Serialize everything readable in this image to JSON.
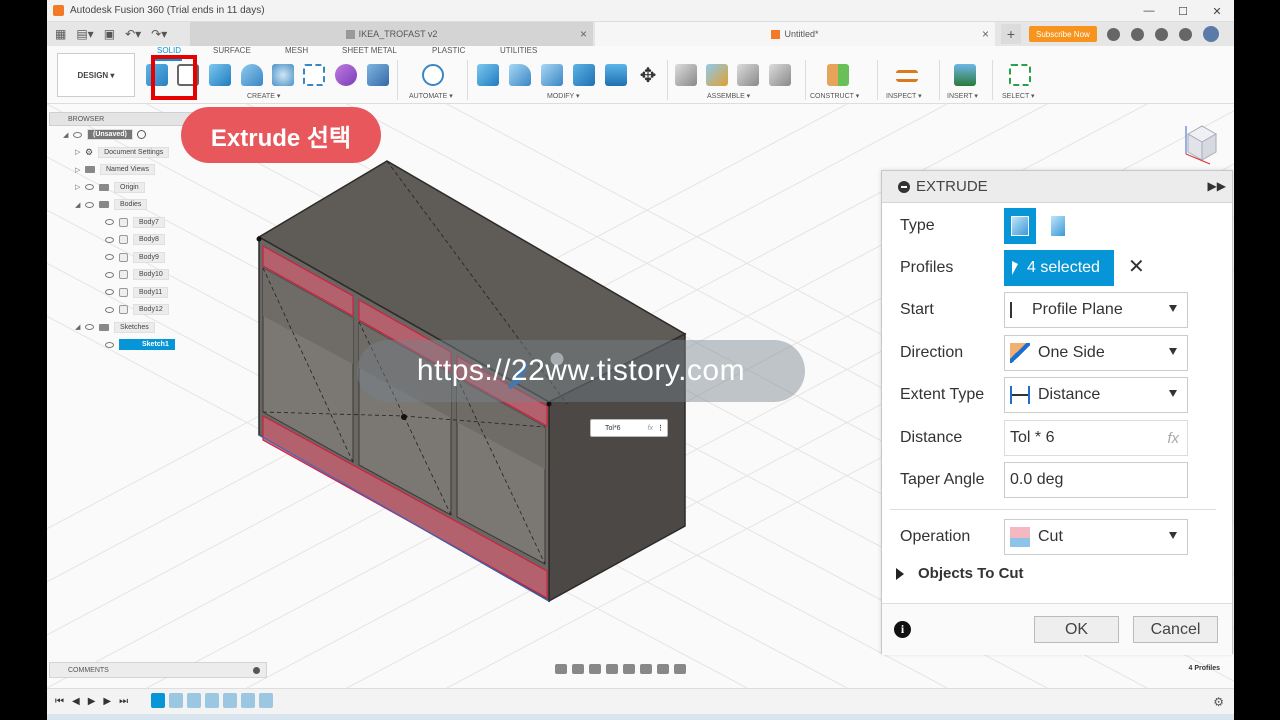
{
  "window": {
    "title": "Autodesk Fusion 360 (Trial ends in 11 days)",
    "controls": [
      "—",
      "☐",
      "✕"
    ]
  },
  "tabs": {
    "inactive": "IKEA_TROFAST v2",
    "active": "Untitled*",
    "subscribe": "Subscribe Now"
  },
  "ribbon": {
    "design": "DESIGN ▾",
    "tab_labels": [
      "SOLID",
      "SURFACE",
      "MESH",
      "SHEET METAL",
      "PLASTIC",
      "UTILITIES"
    ],
    "groups": [
      "CREATE ▾",
      "AUTOMATE ▾",
      "MODIFY ▾",
      "ASSEMBLE ▾",
      "CONSTRUCT ▾",
      "INSPECT ▾",
      "INSERT ▾",
      "SELECT ▾"
    ]
  },
  "callout": "Extrude 선택",
  "watermark": "https://22ww.tistory.com",
  "browser": {
    "header": "BROWSER",
    "root": "(Unsaved)",
    "items": {
      "doc_settings": "Document Settings",
      "named_views": "Named Views",
      "origin": "Origin",
      "bodies": "Bodies",
      "body7": "Body7",
      "body8": "Body8",
      "body9": "Body9",
      "body10": "Body10",
      "body11": "Body11",
      "body12": "Body12",
      "sketches": "Sketches",
      "sketch1": "Sketch1"
    }
  },
  "dim_input": {
    "value": "Tol*6",
    "fx": "fx",
    "more": "⋮"
  },
  "extrude": {
    "title": "EXTRUDE",
    "type_label": "Type",
    "profiles_label": "Profiles",
    "profiles_value": "4 selected",
    "start_label": "Start",
    "start_value": "Profile Plane",
    "direction_label": "Direction",
    "direction_value": "One Side",
    "extent_label": "Extent Type",
    "extent_value": "Distance",
    "distance_label": "Distance",
    "distance_value": "Tol * 6",
    "distance_fx": "fx",
    "taper_label": "Taper Angle",
    "taper_value": "0.0 deg",
    "operation_label": "Operation",
    "operation_value": "Cut",
    "objects_to_cut": "Objects To Cut",
    "ok": "OK",
    "cancel": "Cancel",
    "clear": "✕",
    "collapse": "▶▶",
    "info": "i"
  },
  "bottom": {
    "comments": "COMMENTS",
    "profiles_count": "4 Profiles"
  },
  "timeline": {
    "controls": [
      "⏮",
      "◀",
      "▶",
      "▶",
      "⏭"
    ],
    "gear": "⚙"
  },
  "colors": {
    "accent": "#0696d7",
    "callout": "#e8575c",
    "highlight": "#e60000",
    "model": "#55524f",
    "cut_profile": "#c0606f"
  }
}
